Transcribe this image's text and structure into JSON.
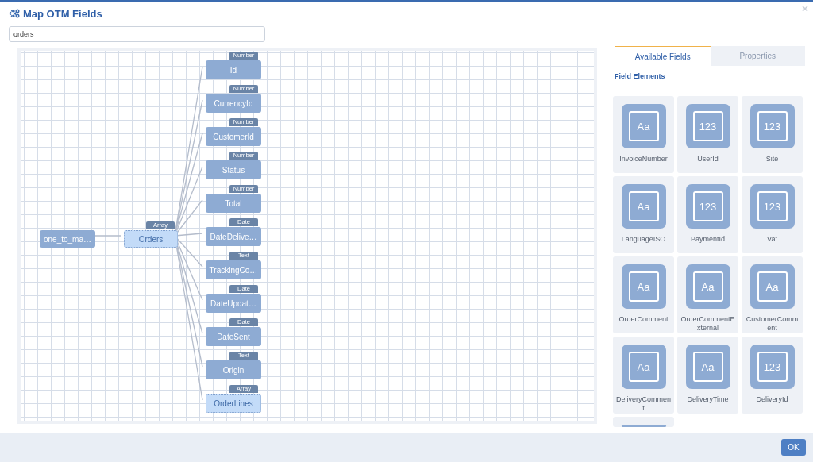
{
  "window": {
    "title": "Map OTM Fields"
  },
  "search": {
    "value": "orders"
  },
  "diagram": {
    "root": {
      "label": "one_to_ma…",
      "children": [
        {
          "label": "Orders",
          "type": "Array",
          "children": [
            {
              "label": "Id",
              "type": "Number"
            },
            {
              "label": "CurrencyId",
              "type": "Number"
            },
            {
              "label": "CustomerId",
              "type": "Number"
            },
            {
              "label": "Status",
              "type": "Number"
            },
            {
              "label": "Total",
              "type": "Number"
            },
            {
              "label": "DateDelive…",
              "type": "Date"
            },
            {
              "label": "TrackingCo…",
              "type": "Text"
            },
            {
              "label": "DateUpdat…",
              "type": "Date"
            },
            {
              "label": "DateSent",
              "type": "Date"
            },
            {
              "label": "Origin",
              "type": "Text"
            },
            {
              "label": "OrderLines",
              "type": "Array"
            }
          ]
        }
      ]
    }
  },
  "tabs": [
    {
      "label": "Available Fields",
      "selected": true
    },
    {
      "label": "Properties",
      "selected": false
    }
  ],
  "section_title": "Field Elements",
  "fields": [
    {
      "label": "InvoiceNumber",
      "glyph": "Aa"
    },
    {
      "label": "UserId",
      "glyph": "123"
    },
    {
      "label": "Site",
      "glyph": "123"
    },
    {
      "label": "LanguageISO",
      "glyph": "Aa"
    },
    {
      "label": "PaymentId",
      "glyph": "123"
    },
    {
      "label": "Vat",
      "glyph": "123"
    },
    {
      "label": "OrderComment",
      "glyph": "Aa"
    },
    {
      "label": "OrderCommentExternal",
      "glyph": "Aa"
    },
    {
      "label": "CustomerComment",
      "glyph": "Aa"
    },
    {
      "label": "DeliveryComment",
      "glyph": "Aa"
    },
    {
      "label": "DeliveryTime",
      "glyph": "Aa"
    },
    {
      "label": "DeliveryId",
      "glyph": "123"
    },
    {
      "kind": "partial"
    }
  ],
  "footer": {
    "ok_button": "OK"
  }
}
